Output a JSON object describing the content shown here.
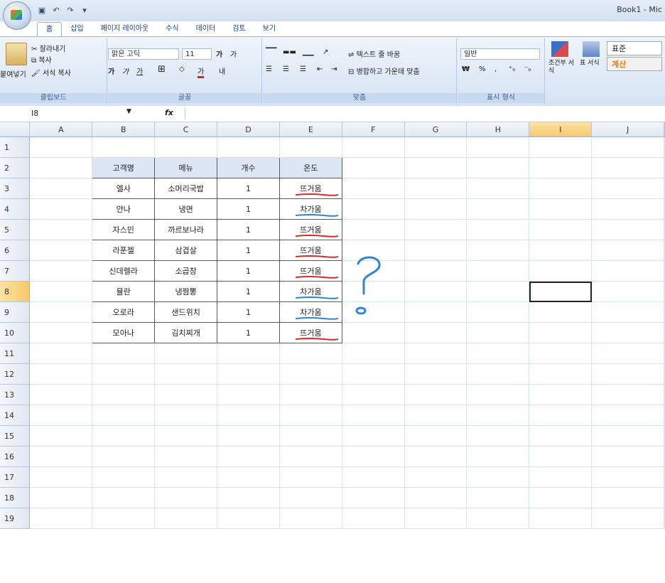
{
  "window": {
    "title": "Book1 - Mic"
  },
  "tabs": [
    "홈",
    "삽입",
    "페이지 레이아웃",
    "수식",
    "데이터",
    "검토",
    "보기"
  ],
  "ribbon": {
    "clipboard": {
      "paste": "붙여넣기",
      "cut": "잘라내기",
      "copy": "복사",
      "format_painter": "서식 복사",
      "label": "클립보드"
    },
    "font": {
      "name": "맑은 고딕",
      "size": "11",
      "label": "글꼴",
      "bold": "가",
      "italic": "가",
      "underline": "가",
      "border": "⊞",
      "grow": "가",
      "shrink": "가",
      "color": "가",
      "phonetic": "내"
    },
    "alignment": {
      "wrap": "텍스트 줄 바꿈",
      "merge": "병합하고 가운데 맞춤",
      "label": "맞춤"
    },
    "number": {
      "format": "일반",
      "label": "표시 형식",
      "currency": "₩",
      "percent": "%",
      "comma": ","
    },
    "styles": {
      "conditional": "조건부 서식",
      "table": "표 서식",
      "normal": "표준",
      "calc": "계산"
    }
  },
  "formula_bar": {
    "name_box": "I8",
    "fx": "fx",
    "value": ""
  },
  "columns": [
    "A",
    "B",
    "C",
    "D",
    "E",
    "F",
    "G",
    "H",
    "I",
    "J"
  ],
  "rows": [
    "1",
    "2",
    "3",
    "4",
    "5",
    "6",
    "7",
    "8",
    "9",
    "10",
    "11",
    "12",
    "13",
    "14",
    "15",
    "16",
    "17",
    "18",
    "19"
  ],
  "selected_cell": {
    "col": "I",
    "row": "8"
  },
  "table": {
    "headers": [
      "고객명",
      "메뉴",
      "개수",
      "온도"
    ],
    "rows": [
      [
        "엘사",
        "소머리국밥",
        "1",
        "뜨거움"
      ],
      [
        "안나",
        "냉면",
        "1",
        "차가움"
      ],
      [
        "자스민",
        "까르보나라",
        "1",
        "뜨거움"
      ],
      [
        "라푼젤",
        "삼겹살",
        "1",
        "뜨거움"
      ],
      [
        "신데렐라",
        "소곱창",
        "1",
        "뜨거움"
      ],
      [
        "뮬란",
        "냉짬뽕",
        "1",
        "차가움"
      ],
      [
        "오로라",
        "샌드위치",
        "1",
        "차가움"
      ],
      [
        "모아나",
        "김치찌개",
        "1",
        "뜨거움"
      ]
    ]
  },
  "annotation_colors": {
    "hot": "#d62b2b",
    "cold": "#2a86d6"
  }
}
